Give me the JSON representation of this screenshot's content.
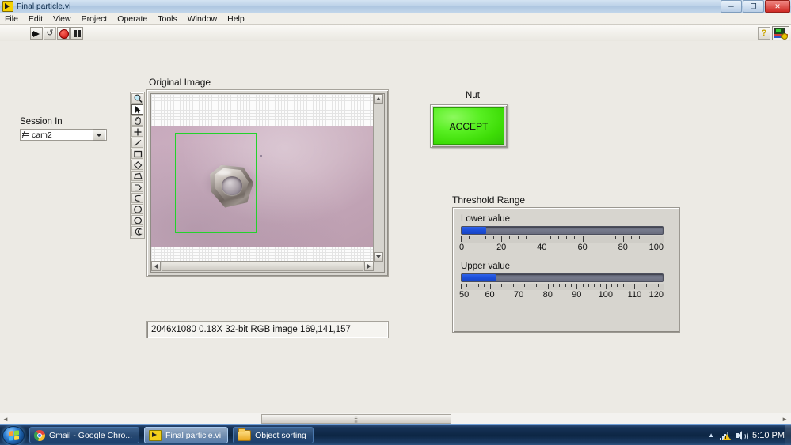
{
  "window": {
    "title": "Final particle.vi",
    "icon": "labview-vi-icon",
    "minimize": "─",
    "maximize": "❐",
    "close": "✕"
  },
  "menu": {
    "items": [
      "File",
      "Edit",
      "View",
      "Project",
      "Operate",
      "Tools",
      "Window",
      "Help"
    ]
  },
  "toolbar": {
    "buttons": [
      {
        "name": "run-button",
        "icon": "run-arrow-icon",
        "tooltip": "Run"
      },
      {
        "name": "run-continuously-button",
        "icon": "run-continuously-icon",
        "tooltip": "Run Continuously"
      },
      {
        "name": "abort-button",
        "icon": "abort-stop-icon",
        "tooltip": "Abort Execution"
      },
      {
        "name": "pause-button",
        "icon": "pause-icon",
        "tooltip": "Pause"
      }
    ],
    "help_label": "?",
    "vi_icon": "vi-connector-pane-icon"
  },
  "session": {
    "label": "Session In",
    "value": "cam2",
    "glyph": "io-session-icon"
  },
  "image_viewer": {
    "title": "Original Image",
    "status": "2046x1080 0.18X 32-bit RGB image 169,141,157",
    "roi": {
      "color": "#22d32b",
      "shape": "rectangle"
    },
    "scroll": {
      "up": "▲",
      "down": "▼",
      "left": "◄",
      "right": "►"
    }
  },
  "tool_palette": {
    "tools": [
      {
        "name": "zoom-tool",
        "icon": "magnifier-icon",
        "selected": false
      },
      {
        "name": "selection-tool",
        "icon": "arrow-cursor-icon",
        "selected": true
      },
      {
        "name": "pan-tool",
        "icon": "hand-icon",
        "selected": false
      },
      {
        "name": "point-tool",
        "icon": "crosshair-icon",
        "selected": false
      },
      {
        "name": "line-tool",
        "icon": "line-icon",
        "selected": false
      },
      {
        "name": "rectangle-tool",
        "icon": "rectangle-icon",
        "selected": false
      },
      {
        "name": "rotated-rectangle-tool",
        "icon": "diamond-icon",
        "selected": false
      },
      {
        "name": "polygon-tool",
        "icon": "polygon-icon",
        "selected": false
      },
      {
        "name": "broken-line-tool",
        "icon": "broken-line-icon",
        "selected": false
      },
      {
        "name": "freehand-line-tool",
        "icon": "freehand-line-icon",
        "selected": false
      },
      {
        "name": "freehand-region-tool",
        "icon": "freehand-region-icon",
        "selected": false
      },
      {
        "name": "oval-tool",
        "icon": "oval-icon",
        "selected": false
      },
      {
        "name": "annulus-tool",
        "icon": "annulus-icon",
        "selected": false
      }
    ]
  },
  "nut_indicator": {
    "label": "Nut",
    "value": "ACCEPT",
    "color": "#44e313"
  },
  "threshold": {
    "title": "Threshold Range",
    "lower": {
      "label": "Lower value",
      "value": 12,
      "min": 0,
      "max": 100,
      "tick_labels": [
        "0",
        "20",
        "40",
        "60",
        "80",
        "100"
      ],
      "fill_percent": 12.1
    },
    "upper": {
      "label": "Upper value",
      "value": 62,
      "min": 50,
      "max": 120,
      "tick_labels": [
        "50",
        "60",
        "70",
        "80",
        "90",
        "100",
        "110",
        "120"
      ],
      "fill_percent": 16.8
    },
    "fill_color": "#1d50db"
  },
  "panel_scroll": {
    "left_arrow": "◄",
    "right_arrow": "►",
    "grip": "⣿"
  },
  "taskbar": {
    "start": "start-orb",
    "tasks": [
      {
        "name": "taskbar-item-chrome",
        "label": "Gmail - Google Chro...",
        "icon": "chrome-icon",
        "active": false
      },
      {
        "name": "taskbar-item-labview",
        "label": "Final particle.vi",
        "icon": "labview-vi-icon",
        "active": true
      },
      {
        "name": "taskbar-item-folder",
        "label": "Object sorting",
        "icon": "folder-icon",
        "active": false
      }
    ],
    "tray": {
      "overflow": "▲",
      "network": "network-warning-icon",
      "volume": "volume-icon",
      "clock": "5:10 PM"
    }
  }
}
